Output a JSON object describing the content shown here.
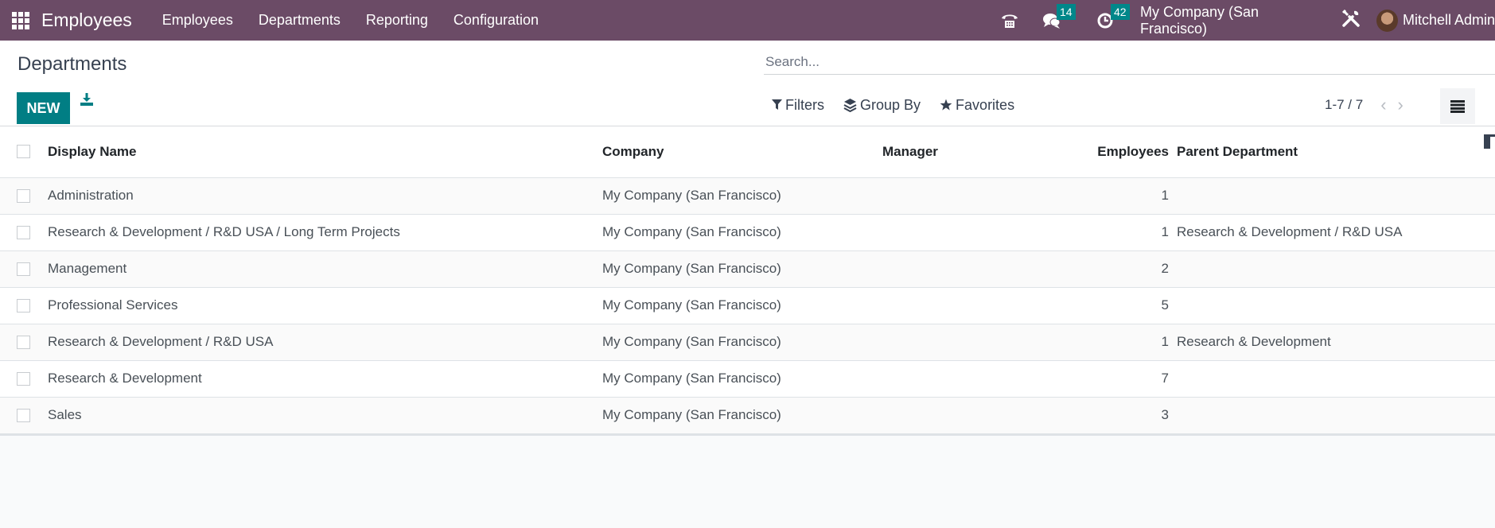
{
  "navbar": {
    "app_title": "Employees",
    "menu": [
      "Employees",
      "Departments",
      "Reporting",
      "Configuration"
    ],
    "messages_count": "14",
    "activities_count": "42",
    "company": "My Company (San Francisco)",
    "user": "Mitchell Admin"
  },
  "control_panel": {
    "title": "Departments",
    "new_label": "NEW",
    "search_placeholder": "Search...",
    "filters_label": "Filters",
    "group_by_label": "Group By",
    "favorites_label": "Favorites",
    "pager": "1-7 / 7"
  },
  "table": {
    "columns": [
      "Display Name",
      "Company",
      "Manager",
      "Employees",
      "Parent Department"
    ],
    "rows": [
      {
        "name": "Administration",
        "company": "My Company (San Francisco)",
        "manager": "",
        "employees": "1",
        "parent": ""
      },
      {
        "name": "Research & Development / R&D USA / Long Term Projects",
        "company": "My Company (San Francisco)",
        "manager": "",
        "employees": "1",
        "parent": "Research & Development / R&D USA"
      },
      {
        "name": "Management",
        "company": "My Company (San Francisco)",
        "manager": "",
        "employees": "2",
        "parent": ""
      },
      {
        "name": "Professional Services",
        "company": "My Company (San Francisco)",
        "manager": "",
        "employees": "5",
        "parent": ""
      },
      {
        "name": "Research & Development / R&D USA",
        "company": "My Company (San Francisco)",
        "manager": "",
        "employees": "1",
        "parent": "Research & Development"
      },
      {
        "name": "Research & Development",
        "company": "My Company (San Francisco)",
        "manager": "",
        "employees": "7",
        "parent": ""
      },
      {
        "name": "Sales",
        "company": "My Company (San Francisco)",
        "manager": "",
        "employees": "3",
        "parent": ""
      }
    ]
  },
  "colors": {
    "navbar": "#6b4b66",
    "primary": "#017e84",
    "badge": "#00878a"
  }
}
